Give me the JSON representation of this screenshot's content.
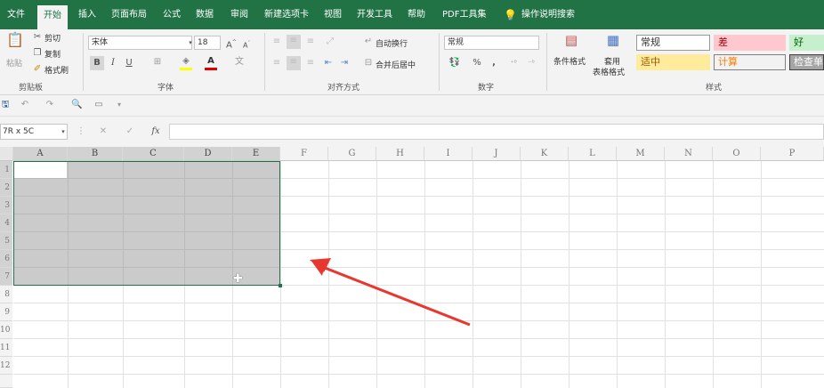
{
  "tabs": [
    "文件",
    "开始",
    "插入",
    "页面布局",
    "公式",
    "数据",
    "审阅",
    "新建选项卡",
    "视图",
    "开发工具",
    "帮助",
    "PDF工具集"
  ],
  "active_tab": "开始",
  "tell_me": "操作说明搜索",
  "clipboard": {
    "paste": "粘贴",
    "cut": "剪切",
    "copy": "复制",
    "format_painter": "格式刷",
    "group": "剪贴板"
  },
  "font": {
    "name": "宋体",
    "size": "18",
    "group": "字体",
    "bold": "B",
    "italic": "I",
    "underline": "U"
  },
  "alignment": {
    "wrap": "自动换行",
    "merge": "合并后居中",
    "group": "对齐方式"
  },
  "number": {
    "format": "常规",
    "group": "数字",
    "percent": "%",
    "comma": ","
  },
  "styles": {
    "conditional": "条件格式",
    "table_format_1": "套用",
    "table_format_2": "表格格式",
    "group": "样式",
    "cells": [
      {
        "label": "常规",
        "bg": "#ffffff",
        "fg": "#333333",
        "border": "#999999"
      },
      {
        "label": "差",
        "bg": "#ffc7ce",
        "fg": "#9c0006",
        "border": "#ffc7ce"
      },
      {
        "label": "好",
        "bg": "#c6efce",
        "fg": "#006100",
        "border": "#c6efce"
      },
      {
        "label": "适中",
        "bg": "#ffeb9c",
        "fg": "#9c5700",
        "border": "#ffeb9c"
      },
      {
        "label": "计算",
        "bg": "#f2f2f2",
        "fg": "#fa7d00",
        "border": "#7f7f7f"
      },
      {
        "label": "检查单",
        "bg": "#a5a5a5",
        "fg": "#ffffff",
        "border": "#3f3f3f"
      }
    ]
  },
  "formula_bar": {
    "name_box": "7R x 5C",
    "fx": "fx",
    "cancel": "✕",
    "enter": "✓"
  },
  "columns": [
    "A",
    "B",
    "C",
    "D",
    "E",
    "F",
    "G",
    "H",
    "I",
    "J",
    "K",
    "L",
    "M",
    "N",
    "O",
    "P"
  ],
  "rows": [
    "1",
    "2",
    "3",
    "4",
    "5",
    "6",
    "7",
    "8",
    "9",
    "10",
    "11",
    "12"
  ],
  "selection": {
    "range": "A1:E7",
    "fill": "#c8c8c8",
    "border": "#217346"
  },
  "colors": {
    "accent": "#217346",
    "annotation_arrow": "#e8372f"
  }
}
